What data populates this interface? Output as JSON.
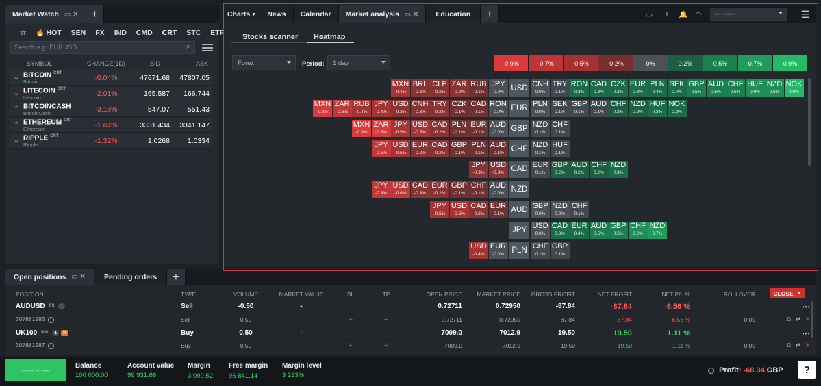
{
  "market_watch": {
    "tab_title": "Market Watch",
    "categories": [
      "HOT",
      "SEN",
      "FX",
      "IND",
      "CMD",
      "CRT",
      "STC",
      "ETF"
    ],
    "active_category": "CRT",
    "search_placeholder": "Search e.g. EURUSD",
    "columns": [
      "SYMBOL",
      "CHANGE(1D)",
      "BID",
      "ASK"
    ],
    "rows": [
      {
        "dir": "down",
        "symbol": "BITCOIN",
        "tag": "CRT",
        "name": "Bitcoin",
        "change": "-0.04%",
        "bid": "47671.68",
        "ask": "47807.05"
      },
      {
        "dir": "down",
        "symbol": "LITECOIN",
        "tag": "CRT",
        "name": "Litecoin",
        "change": "-2.01%",
        "bid": "165.587",
        "ask": "166.744"
      },
      {
        "dir": "up",
        "symbol": "BITCOINCASH",
        "tag": "",
        "name": "BitcoinCash",
        "change": "-3.18%",
        "bid": "547.07",
        "ask": "551.43"
      },
      {
        "dir": "up",
        "symbol": "ETHEREUM",
        "tag": "CRT",
        "name": "Ethereum",
        "change": "-1.64%",
        "bid": "3331.434",
        "ask": "3341.147"
      },
      {
        "dir": "down",
        "symbol": "RIPPLE",
        "tag": "CRT",
        "name": "Ripple",
        "change": "-1.32%",
        "bid": "1.0268",
        "ask": "1.0334"
      }
    ]
  },
  "analysis": {
    "tabs": [
      "Charts",
      "News",
      "Calendar",
      "Market analysis",
      "Education"
    ],
    "active_tab": "Market analysis",
    "subtabs": [
      "Stocks scanner",
      "Heatmap"
    ],
    "active_subtab": "Heatmap",
    "market_select": "Forex",
    "period_label": "Period:",
    "period_select": "1 day",
    "account_masked": "••••••••••",
    "legend": [
      {
        "label": "-0.9%",
        "color": "#d93b3b"
      },
      {
        "label": "-0.7%",
        "color": "#bf3535"
      },
      {
        "label": "-0.5%",
        "color": "#a53131"
      },
      {
        "label": "-0.2%",
        "color": "#7a2f2f"
      },
      {
        "label": "0%",
        "color": "#4b5157"
      },
      {
        "label": "0.2%",
        "color": "#1d5f42"
      },
      {
        "label": "0.5%",
        "color": "#1a8050"
      },
      {
        "label": "0.7%",
        "color": "#1f9c5c"
      },
      {
        "label": "0.9%",
        "color": "#23b967"
      }
    ],
    "heatmap": [
      {
        "base": "USD",
        "left": [
          [
            "MXN",
            "-0.4%"
          ],
          [
            "BRL",
            "-0.3%"
          ],
          [
            "CLP",
            "-0.2%"
          ],
          [
            "ZAR",
            "-0.2%"
          ],
          [
            "RUB",
            "-0.1%"
          ],
          [
            "JPY",
            "-0.0%"
          ]
        ],
        "right": [
          [
            "CNH",
            "0.0%"
          ],
          [
            "TRY",
            "0.1%"
          ],
          [
            "RON",
            "0.3%"
          ],
          [
            "CAD",
            "0.3%"
          ],
          [
            "CZK",
            "0.3%"
          ],
          [
            "EUR",
            "0.3%"
          ],
          [
            "PLN",
            "0.4%"
          ],
          [
            "SEK",
            "0.4%"
          ],
          [
            "GBP",
            "0.5%"
          ],
          [
            "AUD",
            "0.5%"
          ],
          [
            "CHF",
            "0.5%"
          ],
          [
            "HUF",
            "0.6%"
          ],
          [
            "NZD",
            "0.6%"
          ],
          [
            "NOK",
            "0.9%"
          ]
        ]
      },
      {
        "base": "EUR",
        "left": [
          [
            "MXN",
            "-0.8%"
          ],
          [
            "ZAR",
            "-0.6%"
          ],
          [
            "RUB",
            "-0.4%"
          ],
          [
            "JPY",
            "-0.4%"
          ],
          [
            "USD",
            "-0.3%"
          ],
          [
            "CNH",
            "-0.3%"
          ],
          [
            "TRY",
            "-0.2%"
          ],
          [
            "CZK",
            "-0.1%"
          ],
          [
            "CAD",
            "-0.1%"
          ],
          [
            "RON",
            "-0.0%"
          ]
        ],
        "right": [
          [
            "PLN",
            "0.0%"
          ],
          [
            "SEK",
            "0.1%"
          ],
          [
            "GBP",
            "0.1%"
          ],
          [
            "AUD",
            "0.1%"
          ],
          [
            "CHF",
            "0.2%"
          ],
          [
            "NZD",
            "0.2%"
          ],
          [
            "HUF",
            "0.3%"
          ],
          [
            "NOK",
            "0.3%"
          ]
        ]
      },
      {
        "base": "GBP",
        "left": [
          [
            "MXN",
            "-0.9%"
          ],
          [
            "ZAR",
            "-0.8%"
          ],
          [
            "JPY",
            "-0.5%"
          ],
          [
            "USD",
            "-0.5%"
          ],
          [
            "CAD",
            "-0.2%"
          ],
          [
            "PLN",
            "-0.1%"
          ],
          [
            "EUR",
            "-0.1%"
          ],
          [
            "AUD",
            "-0.0%"
          ]
        ],
        "right": [
          [
            "NZD",
            "0.1%"
          ],
          [
            "CHF",
            "0.1%"
          ]
        ]
      },
      {
        "base": "CHF",
        "left": [
          [
            "JPY",
            "-0.6%"
          ],
          [
            "USD",
            "-0.5%"
          ],
          [
            "EUR",
            "-0.2%"
          ],
          [
            "CAD",
            "-0.2%"
          ],
          [
            "GBP",
            "-0.1%"
          ],
          [
            "PLN",
            "-0.1%"
          ],
          [
            "AUD",
            "-0.1%"
          ]
        ],
        "right": [
          [
            "NZD",
            "0.1%"
          ],
          [
            "HUF",
            "0.1%"
          ]
        ]
      },
      {
        "base": "CAD",
        "left": [
          [
            "JPY",
            "-0.3%"
          ],
          [
            "USD",
            "-0.3%"
          ]
        ],
        "right": [
          [
            "EUR",
            "0.1%"
          ],
          [
            "GBP",
            "0.2%"
          ],
          [
            "AUD",
            "0.2%"
          ],
          [
            "CHF",
            "0.2%"
          ],
          [
            "NZD",
            "0.3%"
          ]
        ]
      },
      {
        "base": "NZD",
        "left": [
          [
            "JPY",
            "-0.6%"
          ],
          [
            "USD",
            "-0.6%"
          ],
          [
            "CAD",
            "-0.3%"
          ],
          [
            "EUR",
            "-0.2%"
          ],
          [
            "GBP",
            "-0.1%"
          ],
          [
            "CHF",
            "-0.1%"
          ],
          [
            "AUD",
            "-0.0%"
          ]
        ],
        "right": []
      },
      {
        "base": "AUD",
        "left": [
          [
            "JPY",
            "-0.5%"
          ],
          [
            "USD",
            "-0.5%"
          ],
          [
            "CAD",
            "-0.2%"
          ],
          [
            "EUR",
            "-0.1%"
          ]
        ],
        "right": [
          [
            "GBP",
            "0.0%"
          ],
          [
            "NZD",
            "0.0%"
          ],
          [
            "CHF",
            "0.1%"
          ]
        ]
      },
      {
        "base": "JPY",
        "left": [],
        "right": [
          [
            "USD",
            "0.0%"
          ],
          [
            "CAD",
            "0.3%"
          ],
          [
            "EUR",
            "0.4%"
          ],
          [
            "AUD",
            "0.5%"
          ],
          [
            "GBP",
            "0.5%"
          ],
          [
            "CHF",
            "0.6%"
          ],
          [
            "NZD",
            "0.7%"
          ]
        ]
      },
      {
        "base": "PLN",
        "left": [
          [
            "USD",
            "-0.4%"
          ],
          [
            "EUR",
            "-0.0%"
          ]
        ],
        "right": [
          [
            "CHF",
            "0.1%"
          ],
          [
            "GBP",
            "0.1%"
          ]
        ]
      }
    ]
  },
  "positions": {
    "tabs": [
      "Open positions",
      "Pending orders"
    ],
    "columns": [
      "POSITION",
      "TYPE",
      "VOLUME",
      "MARKET VALUE",
      "SL",
      "TP",
      "OPEN PRICE",
      "MARKET PRICE",
      "GROSS PROFIT",
      "NET PROFIT",
      "NET P/L %",
      "ROLLOVER"
    ],
    "close_label": "CLOSE",
    "rows": [
      {
        "kind": "main",
        "position": "AUDUSD",
        "tag": "FX",
        "count": "1",
        "rtag": "",
        "type": "Sell",
        "volume": "-0.50",
        "market_value": "-",
        "sl": "",
        "tp": "",
        "open": "0.72711",
        "market": "0.72950",
        "gross": "-87.84",
        "net": "-87.84",
        "netpl": "-6.56 %",
        "rollover": "",
        "sign": "neg"
      },
      {
        "kind": "sub",
        "position": "307881985",
        "tag": "",
        "count": "",
        "rtag": "",
        "type": "Sell",
        "volume": "0.50",
        "market_value": "-",
        "sl": "+",
        "tp": "+",
        "open": "0.72711",
        "market": "0.72950",
        "gross": "-87.84",
        "net": "-87.84",
        "netpl": "-6.56 %",
        "rollover": "0.00",
        "sign": "neg"
      },
      {
        "kind": "main",
        "position": "UK100",
        "tag": "IND",
        "count": "1",
        "rtag": "R",
        "type": "Buy",
        "volume": "0.50",
        "market_value": "-",
        "sl": "",
        "tp": "",
        "open": "7009.0",
        "market": "7012.9",
        "gross": "19.50",
        "net": "19.50",
        "netpl": "1.11 %",
        "rollover": "",
        "sign": "pos"
      },
      {
        "kind": "sub",
        "position": "307881987",
        "tag": "",
        "count": "",
        "rtag": "",
        "type": "Buy",
        "volume": "0.50",
        "market_value": "-",
        "sl": "+",
        "tp": "+",
        "open": "7009.0",
        "market": "7012.9",
        "gross": "19.50",
        "net": "19.50",
        "netpl": "1.11 %",
        "rollover": "0.00",
        "sign": "pos"
      }
    ]
  },
  "footer": {
    "green_button": "•••••• •• ••••",
    "stats": [
      {
        "label": "Balance",
        "value": "100 000.00"
      },
      {
        "label": "Account value",
        "value": "99 931.66"
      },
      {
        "label": "Margin",
        "value": "3 090.52"
      },
      {
        "label": "Free margin",
        "value": "96 841.14"
      },
      {
        "label": "Margin level",
        "value": "3 233%"
      }
    ],
    "profit_label": "Profit:",
    "profit_value": "-68.34",
    "profit_currency": "GBP",
    "help": "?"
  }
}
